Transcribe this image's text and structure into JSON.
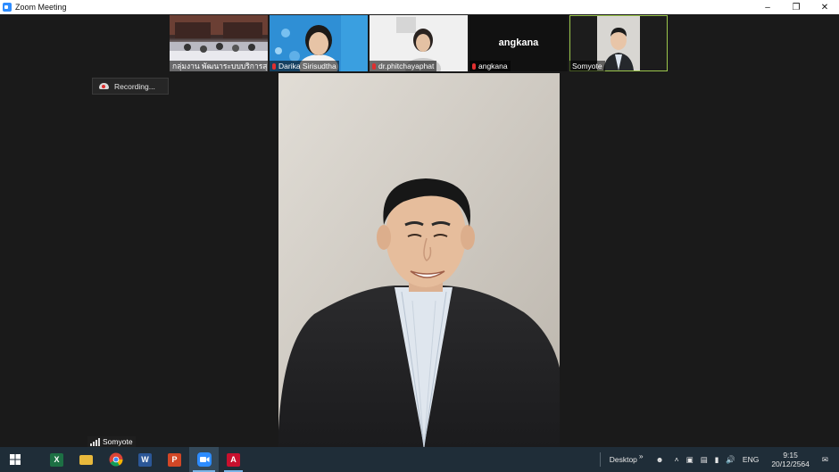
{
  "window": {
    "title": "Zoom Meeting",
    "minimize_icon": "minimize-icon",
    "restore_icon": "restore-icon",
    "close_icon": "close-icon"
  },
  "gallery": [
    {
      "name": "กลุ่มงาน พัฒนาระบบบริการสุ...",
      "muted": false,
      "style": "room"
    },
    {
      "name": "Darika Sirisudtha",
      "muted": true,
      "style": "blue"
    },
    {
      "name": "dr.phitchayaphat",
      "muted": true,
      "style": "white"
    },
    {
      "name": "angkana",
      "muted": true,
      "style": "dark",
      "center_label": "angkana"
    },
    {
      "name": "Somyote",
      "muted": false,
      "style": "active"
    }
  ],
  "recording": {
    "label": "Recording..."
  },
  "active_speaker": {
    "name": "Somyote"
  },
  "taskbar": {
    "apps": [
      "windows-start",
      "excel",
      "file-explorer",
      "chrome",
      "word",
      "powerpoint",
      "zoom",
      "acrobat"
    ],
    "tray": {
      "desktop_label": "Desktop",
      "chevron": "»",
      "language": "ENG",
      "time": "9:15",
      "date": "20/12/2564"
    }
  },
  "colors": {
    "accent_green": "#9cc74c",
    "taskbar": "#1f2d38",
    "muted_red": "#e02f2f",
    "zoom_blue": "#2d8cff"
  }
}
